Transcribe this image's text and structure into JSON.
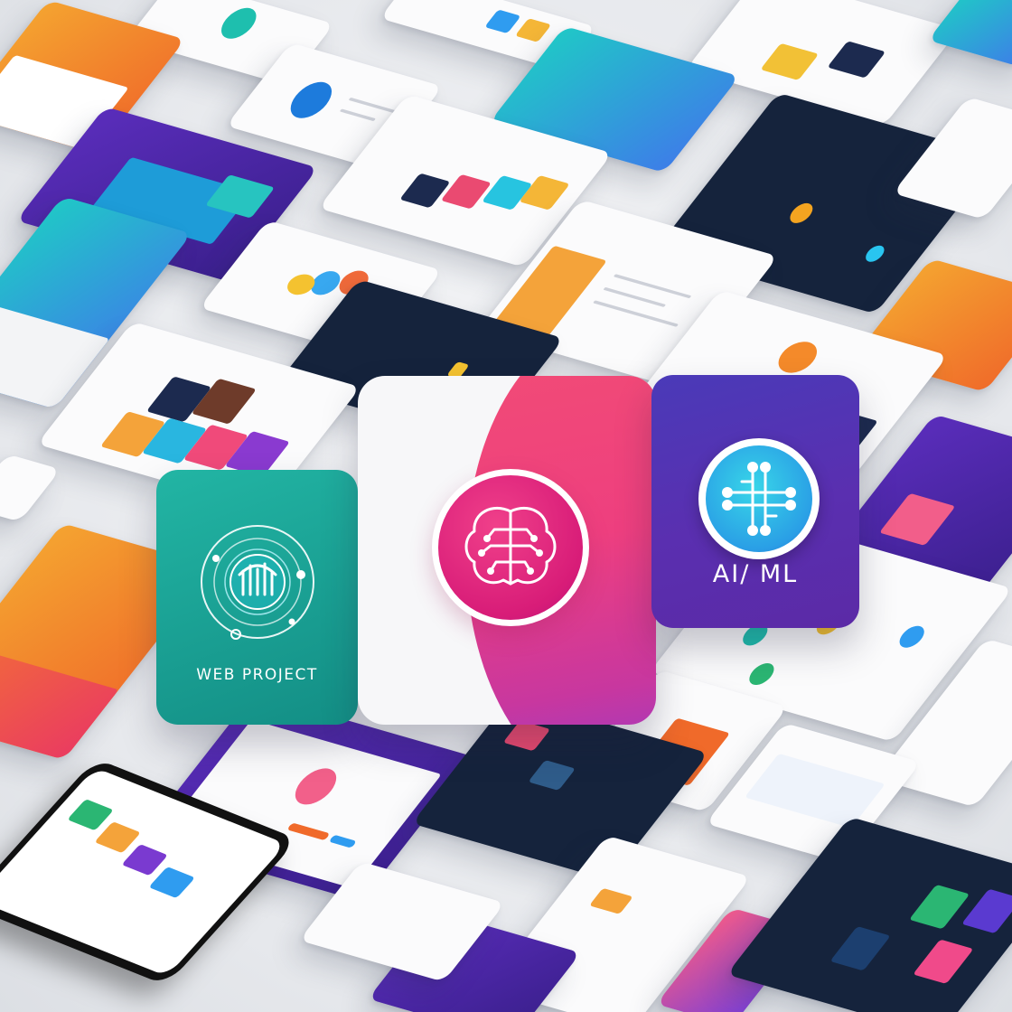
{
  "hero": {
    "web": {
      "label": "WEB PROJECT",
      "icon": "web-project-icon",
      "color": "#1fa595"
    },
    "brain": {
      "icon": "brain-circuit-icon",
      "color": "#e3317f"
    },
    "ai": {
      "label": "AI/ ML",
      "icon": "network-node-icon",
      "color": "#4e34b4"
    }
  },
  "colors": {
    "background": "#e9ebef",
    "teal": "#22b5a4",
    "pink": "#f24e74",
    "magenta": "#d81c78",
    "purple": "#5a2fb0",
    "cyan": "#2a9fe6"
  }
}
